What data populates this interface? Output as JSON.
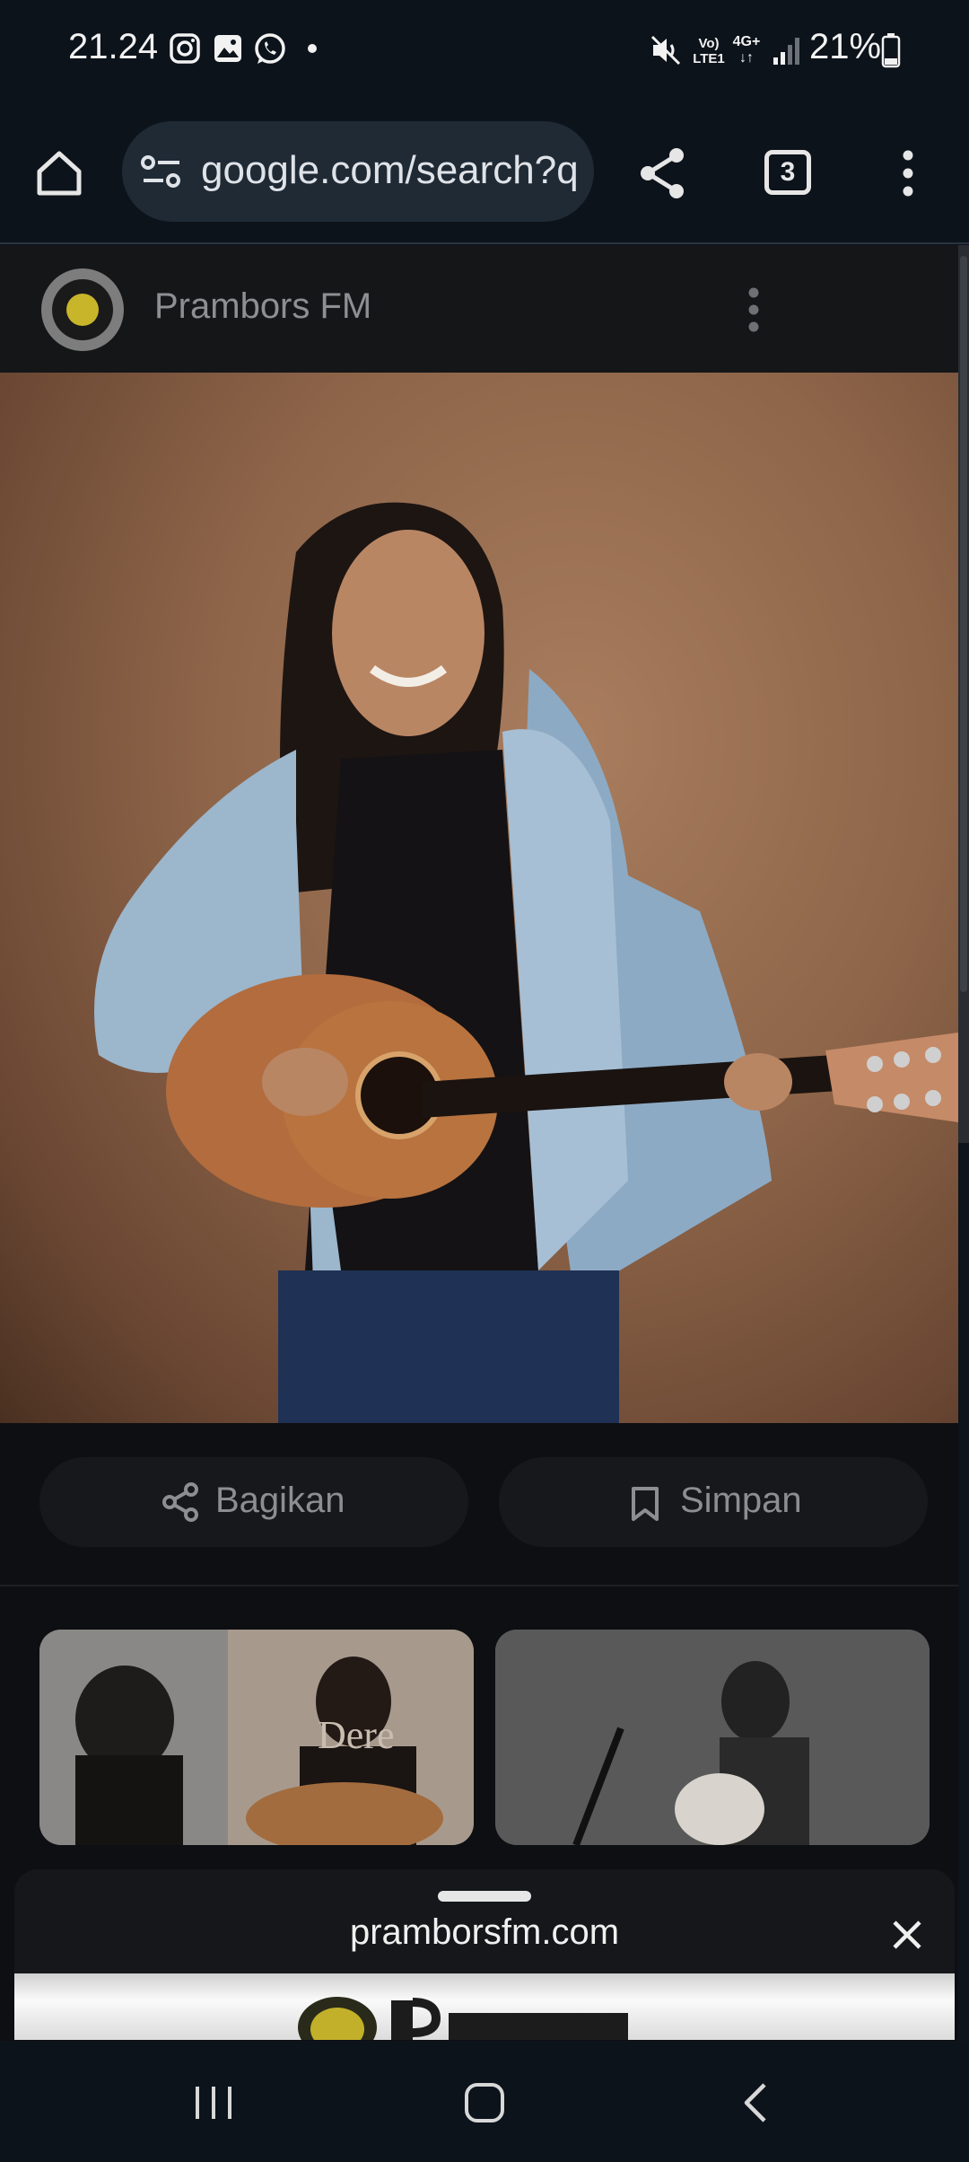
{
  "status_bar": {
    "time": "21.24",
    "network_label_top": "Vo)",
    "network_label_bottom": "LTE1",
    "network_type": "4G+",
    "battery_percent": "21%"
  },
  "browser": {
    "url": "google.com/search?q",
    "tab_count": "3"
  },
  "source": {
    "name": "Prambors FM"
  },
  "actions": {
    "share_label": "Bagikan",
    "save_label": "Simpan"
  },
  "related": {
    "thumb1_overlay": "Dere"
  },
  "sheet": {
    "domain": "pramborsfm.com"
  },
  "colors": {
    "background": "#0e0f12",
    "chrome": "#0d131b",
    "url_pill": "#1f2a35"
  }
}
